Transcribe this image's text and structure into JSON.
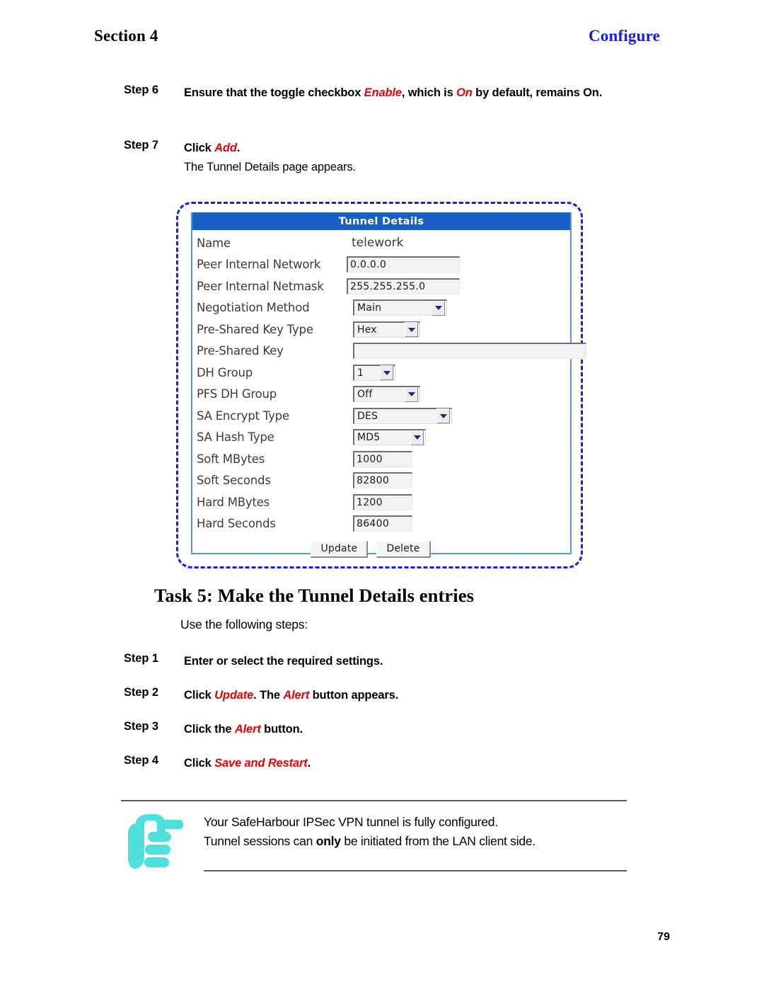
{
  "header": {
    "section": "Section 4",
    "chapter": "Configure"
  },
  "steps_top": [
    {
      "label": "Step 6",
      "parts": [
        {
          "text": "Ensure that the toggle checkbox ",
          "style": "bold"
        },
        {
          "text": "Enable",
          "style": "red-italic"
        },
        {
          "text": ", which is ",
          "style": "bold"
        },
        {
          "text": "On",
          "style": "red-italic"
        },
        {
          "text": " by default, remains On.",
          "style": "bold"
        }
      ]
    },
    {
      "label": "Step 7",
      "parts": [
        {
          "text": "Click ",
          "style": "bold"
        },
        {
          "text": "Add",
          "style": "red-italic"
        },
        {
          "text": ".",
          "style": "bold"
        }
      ],
      "subtext": "The Tunnel Details page appears."
    }
  ],
  "dialog": {
    "title": "Tunnel Details",
    "rows": [
      {
        "label": "Name",
        "type": "text-plain",
        "value": "telework"
      },
      {
        "label": "Peer Internal Network",
        "type": "input",
        "value": "0.0.0.0",
        "width": "w-net"
      },
      {
        "label": "Peer Internal Netmask",
        "type": "input",
        "value": "255.255.255.0",
        "width": "w-net"
      },
      {
        "label": "Negotiation Method",
        "type": "select",
        "value": "Main",
        "width": "w-wide"
      },
      {
        "label": "Pre-Shared Key Type",
        "type": "select",
        "value": "Hex",
        "width": "w-mid"
      },
      {
        "label": "Pre-Shared Key",
        "type": "input",
        "value": "",
        "width": "w-psk"
      },
      {
        "label": "DH Group",
        "type": "select",
        "value": "1",
        "width": "w-narrow"
      },
      {
        "label": "PFS DH Group",
        "type": "select",
        "value": "Off",
        "width": "w-mid"
      },
      {
        "label": "SA Encrypt Type",
        "type": "select",
        "value": "DES",
        "width": "w-enc"
      },
      {
        "label": "SA Hash Type",
        "type": "select",
        "value": "MD5",
        "width": "w-hash"
      },
      {
        "label": "Soft MBytes",
        "type": "input",
        "value": "1000",
        "width": "w-num"
      },
      {
        "label": "Soft Seconds",
        "type": "input",
        "value": "82800",
        "width": "w-num"
      },
      {
        "label": "Hard MBytes",
        "type": "input",
        "value": "1200",
        "width": "w-num"
      },
      {
        "label": "Hard Seconds",
        "type": "input",
        "value": "86400",
        "width": "w-num"
      }
    ],
    "buttons": {
      "update": "Update",
      "delete": "Delete"
    }
  },
  "task": {
    "heading": "Task 5: Make the Tunnel Details entries",
    "intro": "Use the following steps:",
    "steps": [
      {
        "label": "Step 1",
        "parts": [
          {
            "text": "Enter or select the required settings.",
            "style": "bold"
          }
        ]
      },
      {
        "label": "Step 2",
        "parts": [
          {
            "text": "Click ",
            "style": "bold"
          },
          {
            "text": "Update",
            "style": "red-italic"
          },
          {
            "text": ". The ",
            "style": "bold"
          },
          {
            "text": "Alert",
            "style": "red-italic"
          },
          {
            "text": " button appears.",
            "style": "bold"
          }
        ]
      },
      {
        "label": "Step 3",
        "parts": [
          {
            "text": "Click the ",
            "style": "bold"
          },
          {
            "text": "Alert",
            "style": "red-italic"
          },
          {
            "text": " button.",
            "style": "bold"
          }
        ]
      },
      {
        "label": "Step 4",
        "parts": [
          {
            "text": "Click ",
            "style": "bold"
          },
          {
            "text": "Save and Restart",
            "style": "red-italic"
          },
          {
            "text": ".",
            "style": "bold"
          }
        ]
      }
    ]
  },
  "note": {
    "icon": "pointing-hand-icon",
    "icon_color": "#4DE0DC",
    "line1": "Your SafeHarbour IPSec VPN tunnel is fully configured.",
    "line2_before": "Tunnel sessions can ",
    "line2_emphasis": "only",
    "line2_after": " be initiated from the LAN client side."
  },
  "footer": {
    "page_number": "79"
  },
  "colors": {
    "title_bar": "#1a5fc4",
    "accent_blue": "#1a1aee",
    "emphasis_red": "#ee0000",
    "dash_border": "#1a1af0"
  }
}
